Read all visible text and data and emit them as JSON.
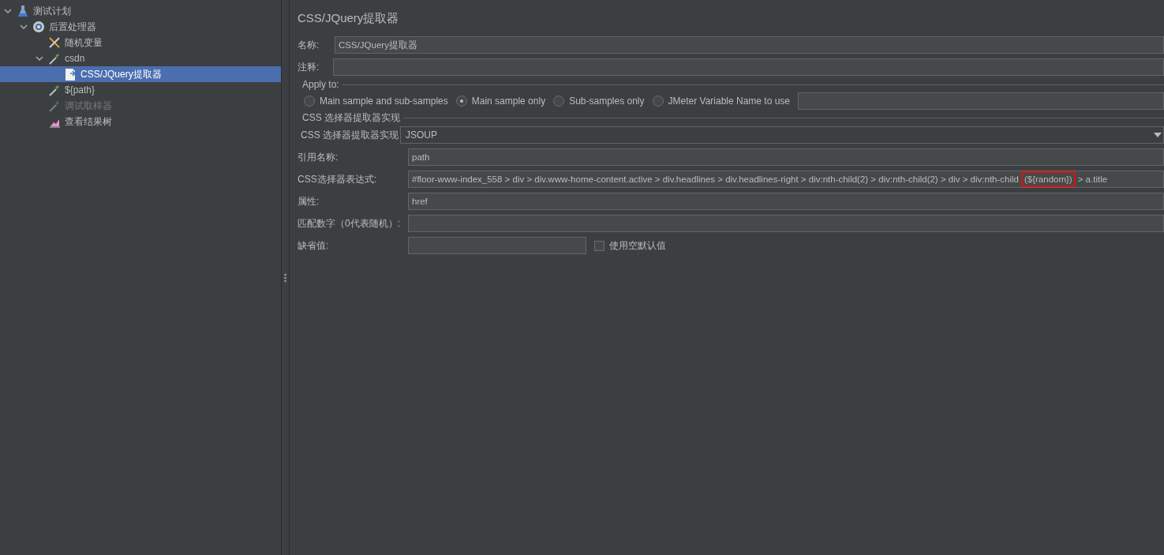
{
  "tree": [
    {
      "label": "测试计划",
      "kind": "flask",
      "expanded": true,
      "selected": false,
      "disabled": false,
      "children": [
        {
          "label": "后置处理器",
          "kind": "gear",
          "expanded": true,
          "selected": false,
          "disabled": false,
          "children": [
            {
              "label": "随机变量",
              "kind": "tools",
              "selected": false,
              "disabled": false
            },
            {
              "label": "csdn",
              "kind": "pipette",
              "expanded": true,
              "selected": false,
              "disabled": false,
              "children": [
                {
                  "label": "CSS/JQuery提取器",
                  "kind": "extractor",
                  "selected": true,
                  "disabled": false
                }
              ]
            },
            {
              "label": "${path}",
              "kind": "pipette",
              "selected": false,
              "disabled": false
            },
            {
              "label": "调试取样器",
              "kind": "pipette",
              "selected": false,
              "disabled": true
            },
            {
              "label": "查看结果树",
              "kind": "chart",
              "selected": false,
              "disabled": false
            }
          ]
        }
      ]
    }
  ],
  "panel": {
    "title": "CSS/JQuery提取器",
    "name": {
      "label": "名称:",
      "value": "CSS/JQuery提取器"
    },
    "comment": {
      "label": "注释:"
    },
    "apply_to": {
      "legend": "Apply to:",
      "options": [
        {
          "label": "Main sample and sub-samples",
          "selected": false
        },
        {
          "label": "Main sample only",
          "selected": true
        },
        {
          "label": "Sub-samples only",
          "selected": false
        },
        {
          "label": "JMeter Variable Name to use",
          "selected": false
        }
      ]
    },
    "impl": {
      "legend": "CSS 选择器提取器实现",
      "label": "CSS 选择器提取器实现",
      "value": "JSOUP"
    },
    "fields": [
      {
        "label": "引用名称:",
        "value": "path"
      },
      {
        "label": "CSS选择器表达式:",
        "value": "#floor-www-index_558 > div > div.www-home-content.active > div.headlines > div.headlines-right > div:nth-child(2) > div:nth-child(2) > div > div:nth-child",
        "highlight": "(${random})",
        "after": " > a.title"
      },
      {
        "label": "属性:",
        "value": "href"
      },
      {
        "label": "匹配数字（0代表随机）:"
      }
    ],
    "default": {
      "label": "缺省值:",
      "checkbox": {
        "label": "使用空默认值",
        "checked": false
      }
    }
  }
}
